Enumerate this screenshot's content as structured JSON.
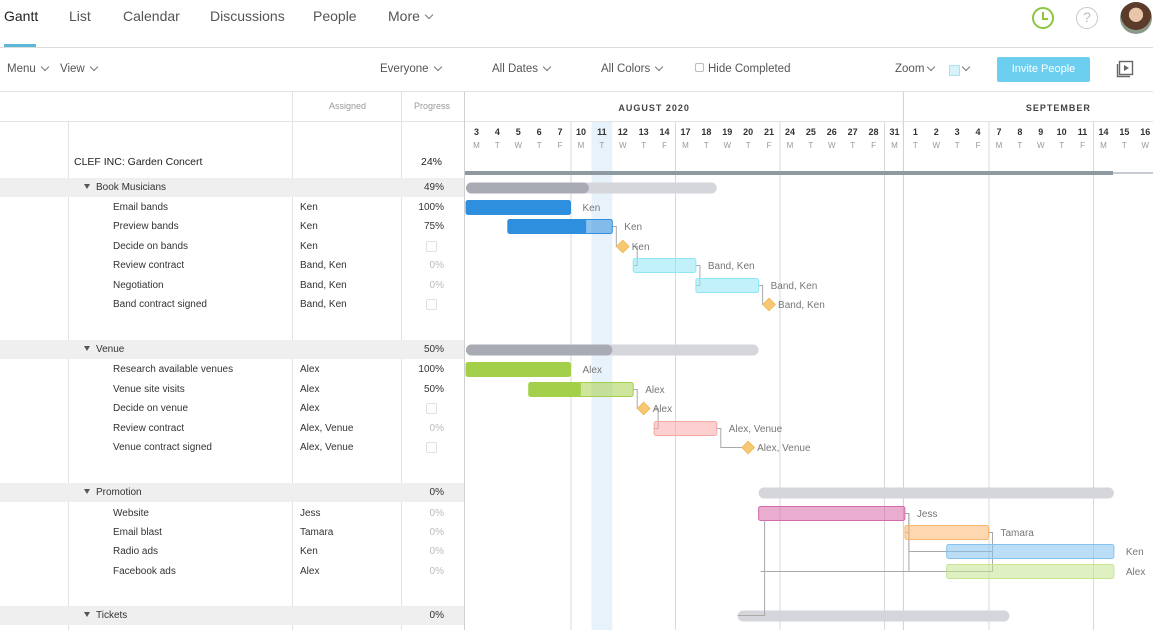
{
  "nav": {
    "tabs": [
      "Gantt",
      "List",
      "Calendar",
      "Discussions",
      "People",
      "More"
    ],
    "help_symbol": "?"
  },
  "toolbar": {
    "menu_label": "Menu",
    "view_label": "View",
    "everyone_label": "Everyone",
    "all_dates_label": "All Dates",
    "all_colors_label": "All Colors",
    "hide_completed_label": "Hide Completed",
    "zoom_label": "Zoom",
    "invite_label": "Invite People"
  },
  "grid": {
    "assigned_header": "Assigned",
    "progress_header": "Progress",
    "project": {
      "name": "CLEF INC: Garden Concert",
      "progress": "24%"
    }
  },
  "timeline": {
    "month1": "AUGUST 2020",
    "month2": "SEPTEMBER",
    "aug_days": [
      "3",
      "4",
      "5",
      "6",
      "7",
      "10",
      "11",
      "12",
      "13",
      "14",
      "17",
      "18",
      "19",
      "20",
      "21",
      "24",
      "25",
      "26",
      "27",
      "28",
      "31"
    ],
    "aug_weekdays": [
      "M",
      "T",
      "W",
      "T",
      "F",
      "M",
      "T",
      "W",
      "T",
      "F",
      "M",
      "T",
      "W",
      "T",
      "F",
      "M",
      "T",
      "W",
      "T",
      "F",
      "M"
    ],
    "sep_days": [
      "1",
      "2",
      "3",
      "4",
      "7",
      "8",
      "9",
      "10",
      "11",
      "14",
      "15",
      "16"
    ],
    "sep_weekdays": [
      "T",
      "W",
      "T",
      "F",
      "M",
      "T",
      "W",
      "T",
      "F",
      "M",
      "T",
      "W"
    ],
    "today_label": "11"
  },
  "rows": [
    {
      "type": "section",
      "name": "Book Musicians",
      "assigned": "",
      "progress": "49%"
    },
    {
      "type": "task",
      "name": "Email bands",
      "assigned": "Ken",
      "progress": "100%"
    },
    {
      "type": "task",
      "name": "Preview bands",
      "assigned": "Ken",
      "progress": "75%"
    },
    {
      "type": "milestone",
      "name": "Decide on bands",
      "assigned": "Ken",
      "progress": ""
    },
    {
      "type": "task",
      "name": "Review contract",
      "assigned": "Band, Ken",
      "progress": "0%"
    },
    {
      "type": "task",
      "name": "Negotiation",
      "assigned": "Band, Ken",
      "progress": "0%"
    },
    {
      "type": "milestone",
      "name": "Band contract signed",
      "assigned": "Band, Ken",
      "progress": ""
    },
    {
      "type": "section",
      "name": "Venue",
      "assigned": "",
      "progress": "50%"
    },
    {
      "type": "task",
      "name": "Research available venues",
      "assigned": "Alex",
      "progress": "100%"
    },
    {
      "type": "task",
      "name": "Venue site visits",
      "assigned": "Alex",
      "progress": "50%"
    },
    {
      "type": "milestone",
      "name": "Decide on venue",
      "assigned": "Alex",
      "progress": ""
    },
    {
      "type": "task",
      "name": "Review contract",
      "assigned": "Alex, Venue",
      "progress": "0%"
    },
    {
      "type": "milestone",
      "name": "Venue contract signed",
      "assigned": "Alex, Venue",
      "progress": ""
    },
    {
      "type": "section",
      "name": "Promotion",
      "assigned": "",
      "progress": "0%"
    },
    {
      "type": "task",
      "name": "Website",
      "assigned": "Jess",
      "progress": "0%"
    },
    {
      "type": "task",
      "name": "Email blast",
      "assigned": "Tamara",
      "progress": "0%"
    },
    {
      "type": "task",
      "name": "Radio ads",
      "assigned": "Ken",
      "progress": "0%"
    },
    {
      "type": "task",
      "name": "Facebook ads",
      "assigned": "Alex",
      "progress": "0%"
    },
    {
      "type": "section",
      "name": "Tickets",
      "assigned": "",
      "progress": "0%"
    }
  ],
  "bars": [
    {
      "row": 0,
      "kind": "summary",
      "start": "Aug 3",
      "end": "Aug 18",
      "done": 0.49
    },
    {
      "row": 1,
      "kind": "task",
      "start": "Aug 3",
      "end": "Aug 7",
      "done": 1.0,
      "color": "#2f8fdf",
      "label": "Ken"
    },
    {
      "row": 2,
      "kind": "task",
      "start": "Aug 5",
      "end": "Aug 11",
      "done": 0.75,
      "color": "#2f8fdf",
      "label": "Ken"
    },
    {
      "row": 3,
      "kind": "milestone",
      "start": "Aug 12",
      "color": "#f7c873",
      "label": "Ken"
    },
    {
      "row": 4,
      "kind": "task",
      "start": "Aug 13",
      "end": "Aug 17",
      "done": 0,
      "color": "#8fe6f5",
      "label": "Band, Ken"
    },
    {
      "row": 5,
      "kind": "task",
      "start": "Aug 18",
      "end": "Aug 20",
      "done": 0,
      "color": "#8fe6f5",
      "label": "Band, Ken"
    },
    {
      "row": 6,
      "kind": "milestone",
      "start": "Aug 21",
      "color": "#f7c873",
      "label": "Band, Ken"
    },
    {
      "row": 7,
      "kind": "summary",
      "start": "Aug 3",
      "end": "Aug 20",
      "done": 0.5
    },
    {
      "row": 8,
      "kind": "task",
      "start": "Aug 3",
      "end": "Aug 7",
      "done": 1.0,
      "color": "#a4cf4a",
      "label": "Alex"
    },
    {
      "row": 9,
      "kind": "task",
      "start": "Aug 6",
      "end": "Aug 12",
      "done": 0.5,
      "color": "#a4cf4a",
      "label": "Alex"
    },
    {
      "row": 10,
      "kind": "milestone",
      "start": "Aug 13",
      "color": "#f7c873",
      "label": "Alex"
    },
    {
      "row": 11,
      "kind": "task",
      "start": "Aug 14",
      "end": "Aug 18",
      "done": 0,
      "color": "#f7a9a5",
      "label": "Alex, Venue"
    },
    {
      "row": 12,
      "kind": "milestone",
      "start": "Aug 20",
      "color": "#f7c873",
      "label": "Alex, Venue"
    },
    {
      "row": 13,
      "kind": "summary",
      "start": "Aug 21",
      "end": "Sep 14",
      "done": 0
    },
    {
      "row": 14,
      "kind": "task",
      "start": "Aug 21",
      "end": "Aug 31",
      "done": 0,
      "color": "#d56aa8",
      "label": "Jess"
    },
    {
      "row": 15,
      "kind": "task",
      "start": "Sep 1",
      "end": "Sep 4",
      "done": 0,
      "color": "#f9b770",
      "label": "Tamara"
    },
    {
      "row": 16,
      "kind": "task",
      "start": "Sep 3",
      "end": "Sep 14",
      "done": 0,
      "color": "#83c3ee",
      "label": "Ken"
    },
    {
      "row": 17,
      "kind": "task",
      "start": "Sep 3",
      "end": "Sep 14",
      "done": 0,
      "color": "#c5e58f",
      "label": "Alex"
    },
    {
      "row": 18,
      "kind": "summary",
      "start": "Aug 20",
      "end": "Sep 7",
      "done": 0
    }
  ]
}
